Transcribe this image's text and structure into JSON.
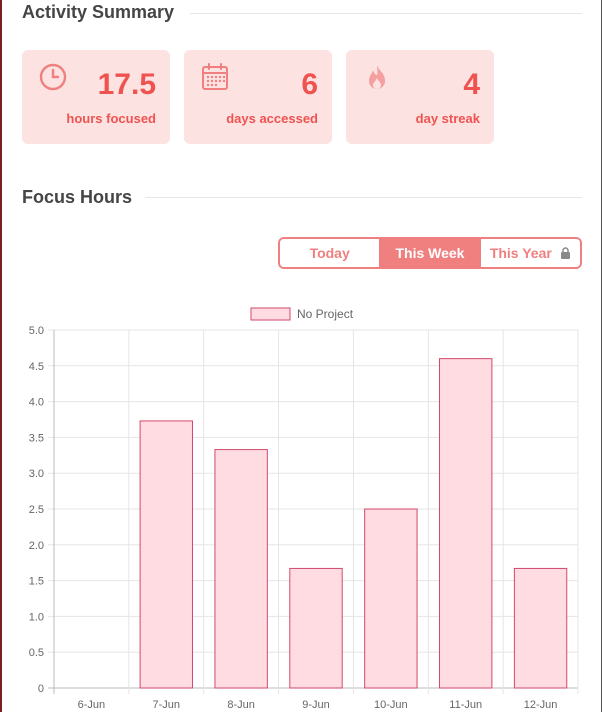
{
  "activity": {
    "title": "Activity Summary",
    "cards": [
      {
        "icon": "clock-icon",
        "value": "17.5",
        "label": "hours focused"
      },
      {
        "icon": "calendar-icon",
        "value": "6",
        "label": "days accessed"
      },
      {
        "icon": "flame-icon",
        "value": "4",
        "label": "day streak"
      }
    ]
  },
  "focus": {
    "title": "Focus Hours",
    "toggle": {
      "options": [
        "Today",
        "This Week",
        "This Year"
      ],
      "selected": "This Week",
      "locked_icon": "lock-icon"
    }
  },
  "colors": {
    "accent": "#ef5350",
    "card_bg": "#fde2e2",
    "toggle": "#f08080",
    "bar_fill": "#ffdce2",
    "bar_stroke": "#d04a6a"
  },
  "chart_data": {
    "type": "bar",
    "categories": [
      "6-Jun",
      "7-Jun",
      "8-Jun",
      "9-Jun",
      "10-Jun",
      "11-Jun",
      "12-Jun"
    ],
    "series": [
      {
        "name": "No Project",
        "values": [
          0,
          3.73,
          3.33,
          1.67,
          2.5,
          4.6,
          1.67
        ]
      }
    ],
    "yticks": [
      "0",
      "0.5",
      "1.0",
      "1.5",
      "2.0",
      "2.5",
      "3.0",
      "3.5",
      "4.0",
      "4.5",
      "5.0"
    ],
    "ylim": [
      0,
      5
    ],
    "grid": true,
    "legend": "top-center",
    "title": "",
    "xlabel": "",
    "ylabel": ""
  }
}
